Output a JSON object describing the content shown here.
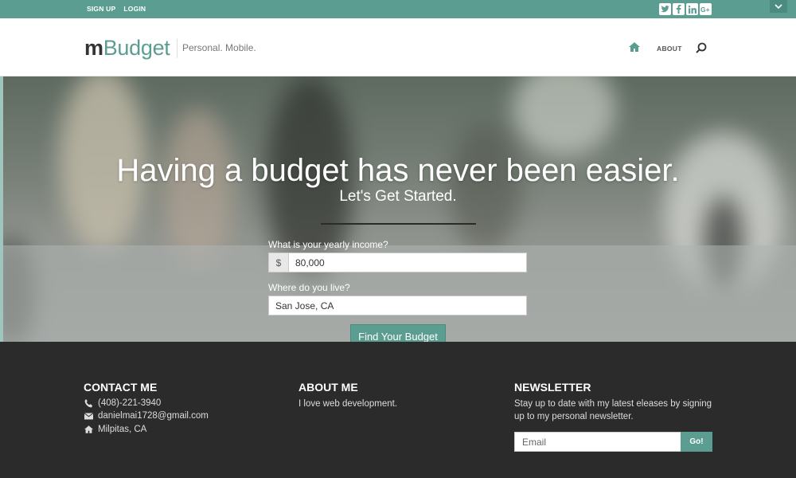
{
  "topbar": {
    "signup_label": "SIGN UP",
    "login_label": "LOGIN",
    "socials": [
      "twitter-icon",
      "facebook-icon",
      "linkedin-icon",
      "google-plus-icon"
    ]
  },
  "header": {
    "logo_prefix": "m",
    "logo_suffix": "Budget",
    "tagline": "Personal. Mobile.",
    "nav_about": "ABOUT"
  },
  "hero": {
    "title": "Having a budget has never been easier.",
    "subtitle": "Let's Get Started.",
    "income_label": "What is your yearly income?",
    "currency": "$",
    "income_value": "80,000",
    "location_label": "Where do you live?",
    "location_value": "San Jose, CA",
    "submit_label": "Find Your Budget"
  },
  "footer": {
    "contact_heading": "CONTACT ME",
    "phone": "(408)-221-3940",
    "email": "danielmai1728@gmail.com",
    "city": "Milpitas, CA",
    "about_heading": "ABOUT ME",
    "about_text": "I love web development.",
    "newsletter_heading": "NEWSLETTER",
    "newsletter_text": "Stay up to date with my latest eleases by signing up to my personal newsletter.",
    "email_placeholder": "Email",
    "go_label": "Go!"
  },
  "colors": {
    "accent": "#5b9e91",
    "footer_bg": "#2b2b2b"
  }
}
